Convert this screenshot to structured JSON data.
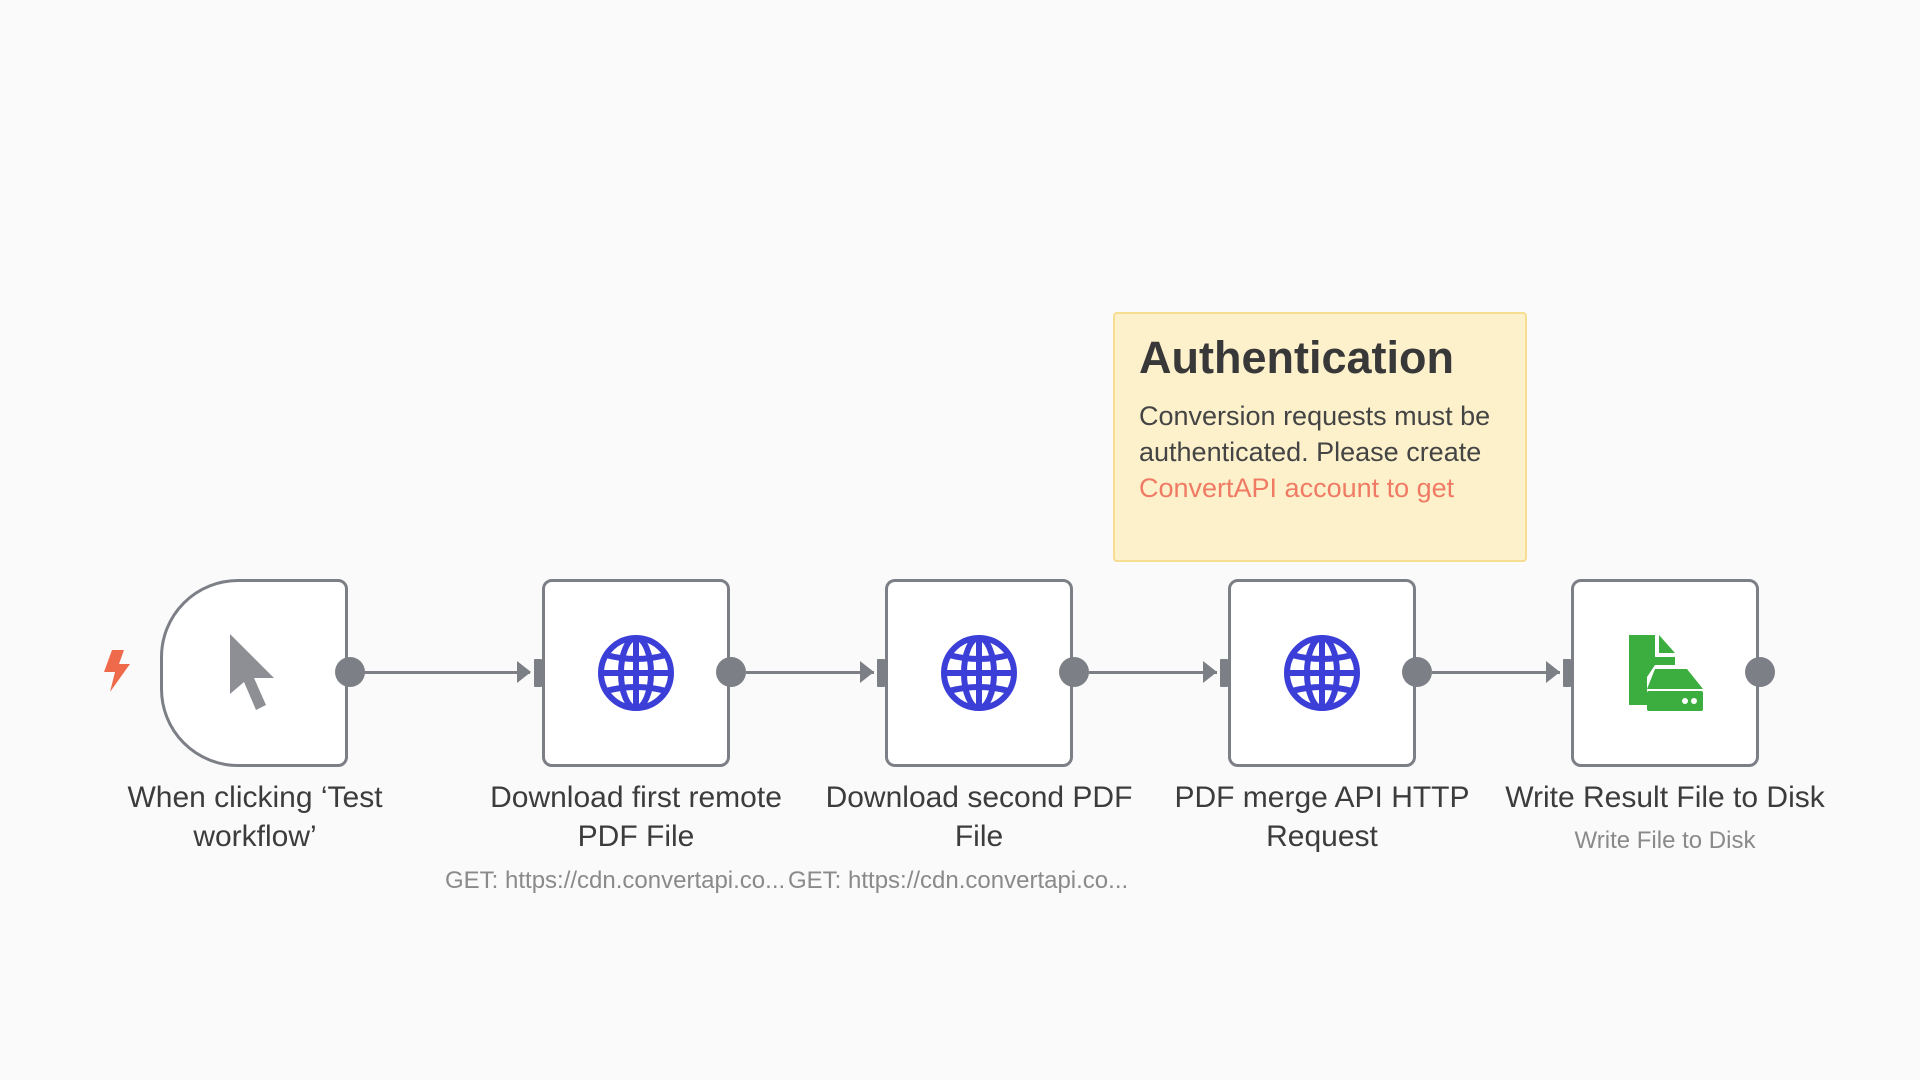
{
  "sticky_note": {
    "title": "Authentication",
    "body": "Conversion requests must be authenticated. Please create",
    "link_text": "ConvertAPI account to get",
    "link_color": "#f07b64",
    "background": "#fdf1cc"
  },
  "nodes": [
    {
      "label": "When clicking ‘Test workflow’",
      "subtitle": "",
      "icon": "cursor-pointer-icon",
      "type": "trigger"
    },
    {
      "label": "Download first remote PDF File",
      "subtitle": "GET: https://cdn.convertapi.co...",
      "icon": "globe-icon",
      "type": "http-request"
    },
    {
      "label": "Download second PDF File",
      "subtitle": "GET: https://cdn.convertapi.co...",
      "icon": "globe-icon",
      "type": "http-request"
    },
    {
      "label": "PDF merge API HTTP Request",
      "subtitle": "",
      "icon": "globe-icon",
      "type": "http-request"
    },
    {
      "label": "Write Result File to Disk",
      "subtitle": "Write File to Disk",
      "icon": "file-disk-icon",
      "type": "write-file"
    }
  ],
  "colors": {
    "canvas": "#fafafa",
    "node_border": "#7c7f86",
    "globe": "#3b3fd8",
    "file_icon": "#3cae3f",
    "trigger_bolt": "#ef6a4b"
  },
  "icons": {
    "trigger_marker": "lightning-bolt-icon"
  }
}
